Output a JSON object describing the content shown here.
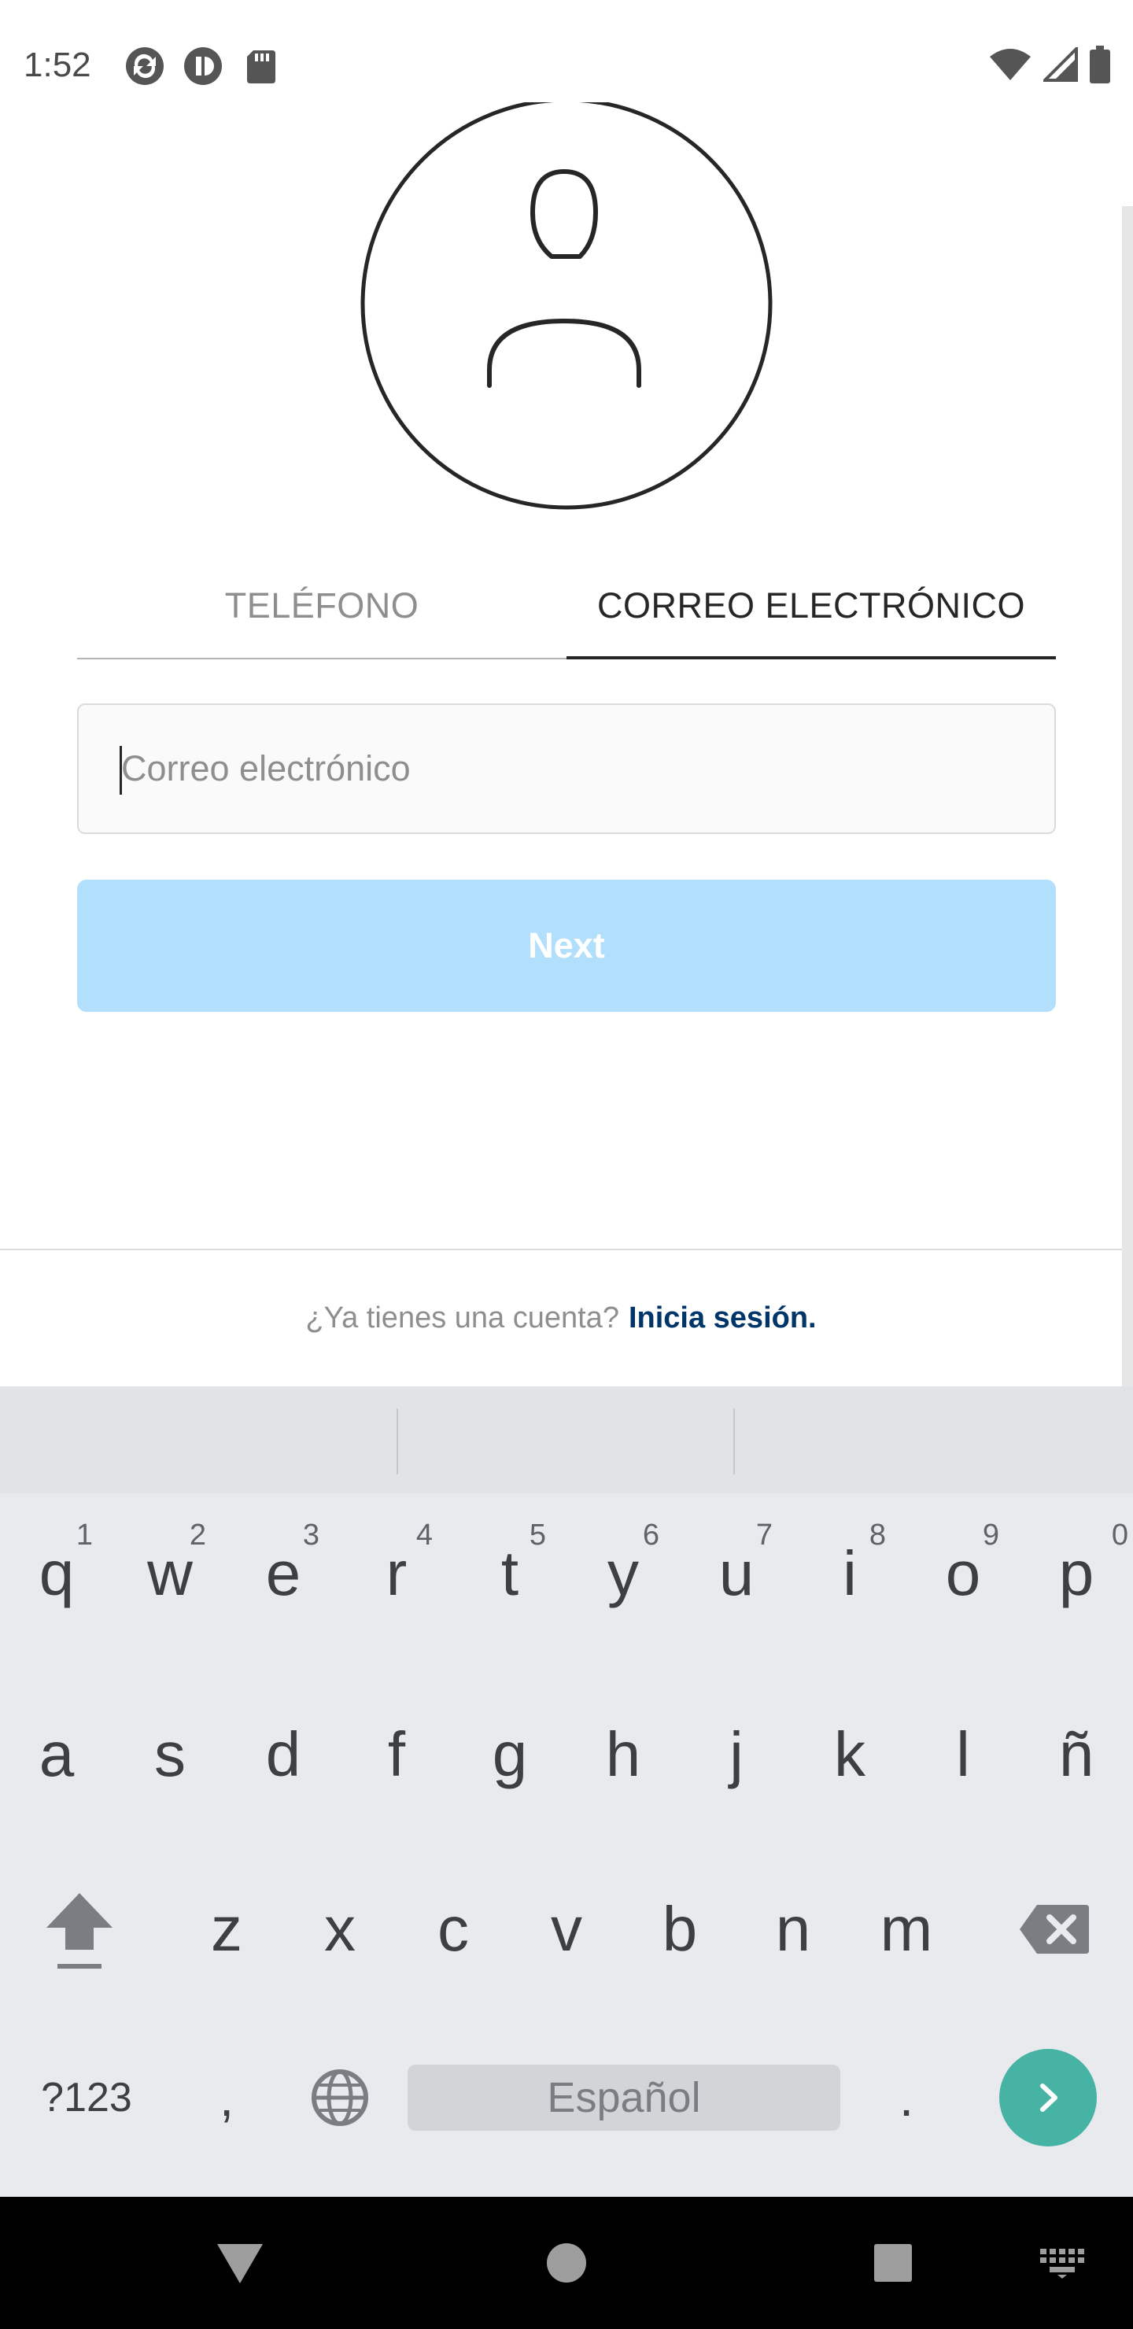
{
  "status_bar": {
    "time": "1:52",
    "left_icons": [
      "sync-icon",
      "pause-circle-icon",
      "sd-card-icon"
    ],
    "right_icons": [
      "wifi-icon",
      "signal-icon",
      "battery-icon"
    ]
  },
  "tabs": [
    {
      "label": "TELÉFONO",
      "active": false
    },
    {
      "label": "CORREO ELECTRÓNICO",
      "active": true
    }
  ],
  "email_input": {
    "value": "",
    "placeholder": "Correo electrónico"
  },
  "next_button": {
    "label": "Next",
    "enabled": false
  },
  "footer": {
    "prompt": "¿Ya tienes una cuenta?",
    "login_link": "Inicia sesión."
  },
  "keyboard": {
    "row1": [
      {
        "letter": "q",
        "hint": "1"
      },
      {
        "letter": "w",
        "hint": "2"
      },
      {
        "letter": "e",
        "hint": "3"
      },
      {
        "letter": "r",
        "hint": "4"
      },
      {
        "letter": "t",
        "hint": "5"
      },
      {
        "letter": "y",
        "hint": "6"
      },
      {
        "letter": "u",
        "hint": "7"
      },
      {
        "letter": "i",
        "hint": "8"
      },
      {
        "letter": "o",
        "hint": "9"
      },
      {
        "letter": "p",
        "hint": "0"
      }
    ],
    "row2": [
      "a",
      "s",
      "d",
      "f",
      "g",
      "h",
      "j",
      "k",
      "l",
      "ñ"
    ],
    "row3": [
      "z",
      "x",
      "c",
      "v",
      "b",
      "n",
      "m"
    ],
    "symbols_label": "?123",
    "comma": ",",
    "space_label": "Español",
    "period": ".",
    "colors": {
      "background": "#e8eaed",
      "enter": "#46b3a4"
    }
  },
  "colors": {
    "next_disabled": "#b2dffc",
    "login_link": "#003569"
  }
}
